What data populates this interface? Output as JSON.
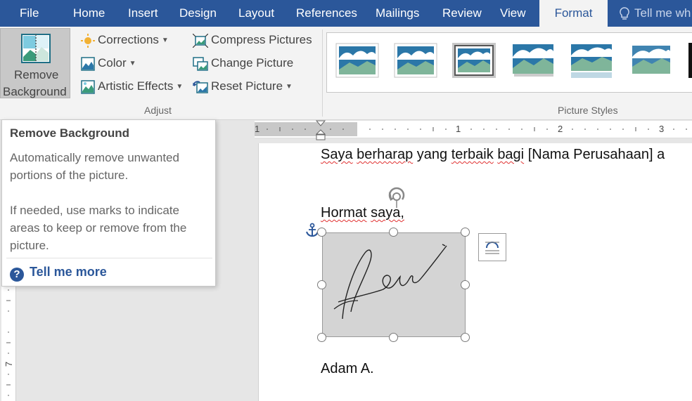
{
  "tabs": [
    "File",
    "Home",
    "Insert",
    "Design",
    "Layout",
    "References",
    "Mailings",
    "Review",
    "View",
    "Format"
  ],
  "active_tab": "Format",
  "tell_me": "Tell me wh",
  "ribbon": {
    "remove_background": {
      "line1": "Remove",
      "line2": "Background"
    },
    "adjust": {
      "corrections": "Corrections",
      "color": "Color",
      "artistic_effects": "Artistic Effects",
      "compress_pictures": "Compress Pictures",
      "change_picture": "Change Picture",
      "reset_picture": "Reset Picture",
      "group_label": "Adjust"
    },
    "picture_styles": {
      "group_label": "Picture Styles"
    }
  },
  "tooltip": {
    "title": "Remove Background",
    "line1": "Automatically remove unwanted",
    "line2": "portions of the picture.",
    "line3": "If needed, use marks to indicate",
    "line4": "areas to keep or remove from the",
    "line5": "picture.",
    "tell_more": "Tell me more"
  },
  "ruler": {
    "marks": [
      "1",
      "1",
      "2",
      "3"
    ]
  },
  "vruler": {
    "mark": "7"
  },
  "document": {
    "line1_words": [
      "Saya",
      "berharap",
      "yang",
      "terbaik",
      "bagi",
      "[Nama",
      "Perusahaan]",
      "a"
    ],
    "closing": [
      "Hormat",
      "saya,"
    ],
    "name": "Adam A."
  },
  "colors": {
    "accent": "#2b579a",
    "tab_bar": "#2b579a",
    "ribbon_bg": "#f3f3f3",
    "spell_error": "#e03030"
  }
}
